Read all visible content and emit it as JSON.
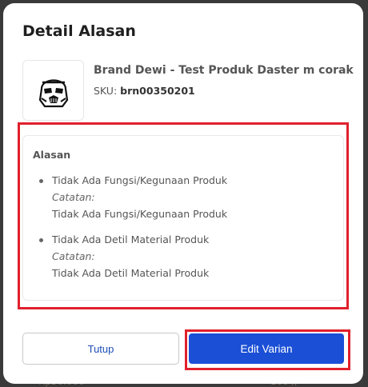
{
  "modal": {
    "title": "Detail Alasan"
  },
  "product": {
    "name": "Brand Dewi - Test Produk Daster m corak",
    "sku_label": "SKU:",
    "sku_value": "brn00350201",
    "image_icon": "stormtrooper-helmet-icon"
  },
  "reasons": {
    "heading": "Alasan",
    "items": [
      {
        "label": "Tidak Ada Fungsi/Kegunaan Produk",
        "note_label": "Catatan:",
        "note_text": "Tidak Ada Fungsi/Kegunaan Produk"
      },
      {
        "label": "Tidak Ada Detil Material Produk",
        "note_label": "Catatan:",
        "note_text": "Tidak Ada Detil Material Produk"
      }
    ]
  },
  "buttons": {
    "close_label": "Tutup",
    "edit_label": "Edit Varian"
  },
  "background": {
    "left_text": "Rp50.000",
    "right_text": "100 //"
  },
  "colors": {
    "primary": "#1a4fd6",
    "highlight": "#e0202c",
    "link": "#1f4fb8"
  }
}
